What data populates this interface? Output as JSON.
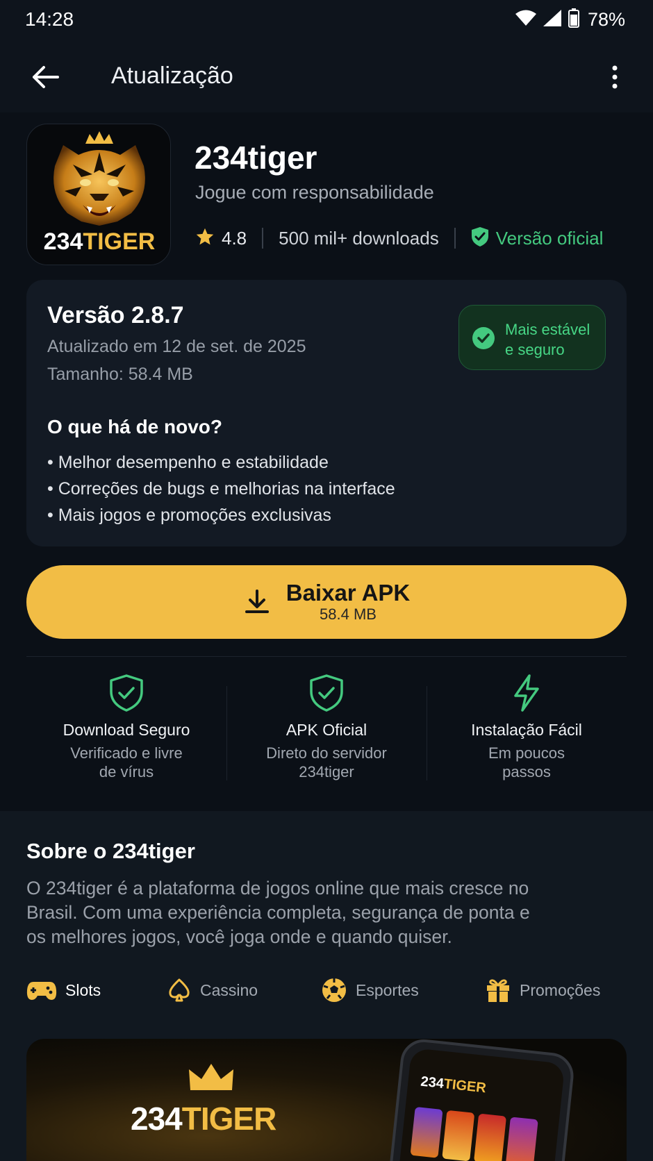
{
  "status_bar": {
    "time": "14:28",
    "battery": "78%"
  },
  "app_bar": {
    "title": "Atualização"
  },
  "app": {
    "name": "234tiger",
    "tagline": "Jogue com responsabilidade",
    "icon_text_num": "234",
    "icon_text_tiger": "TIGER",
    "rating": "4.8",
    "downloads": "500 mil+ downloads",
    "official": "Versão oficial"
  },
  "version": {
    "title": "Versão 2.8.7",
    "updated": "Atualizado em 12 de set. de 2025",
    "size": "Tamanho: 58.4 MB",
    "badge_line1": "Mais estável",
    "badge_line2": "e seguro",
    "whatsnew_title": "O que há de novo?",
    "whatsnew_items": [
      "Melhor desempenho e estabilidade",
      "Correções de bugs e melhorias na interface",
      "Mais jogos e promoções exclusivas"
    ]
  },
  "download": {
    "label": "Baixar APK",
    "size": "58.4 MB"
  },
  "features": [
    {
      "icon": "shield-check-icon",
      "title": "Download Seguro",
      "desc_line1": "Verificado e livre",
      "desc_line2": "de vírus"
    },
    {
      "icon": "shield-check-icon",
      "title": "APK Oficial",
      "desc_line1": "Direto do servidor",
      "desc_line2": "234tiger"
    },
    {
      "icon": "lightning-icon",
      "title": "Instalação Fácil",
      "desc_line1": "Em poucos",
      "desc_line2": "passos"
    }
  ],
  "about": {
    "title": "Sobre o 234tiger",
    "text": "O 234tiger é a plataforma de jogos online que mais cresce no Brasil. Com uma experiência completa, segurança de ponta e os melhores jogos, você joga onde e quando quiser."
  },
  "categories": [
    {
      "label": "Slots",
      "icon": "gamepad-icon",
      "active": true
    },
    {
      "label": "Cassino",
      "icon": "spade-icon",
      "active": false
    },
    {
      "label": "Esportes",
      "icon": "soccer-ball-icon",
      "active": false
    },
    {
      "label": "Promoções",
      "icon": "gift-icon",
      "active": false
    }
  ],
  "banner": {
    "brand_num": "234",
    "brand_tiger": "TIGER",
    "phone_brand_num": "234",
    "phone_brand_tiger": "TIGER"
  },
  "colors": {
    "accent": "#f2bd45",
    "success": "#44c97f",
    "background": "#0b1017",
    "card": "#131a24"
  }
}
